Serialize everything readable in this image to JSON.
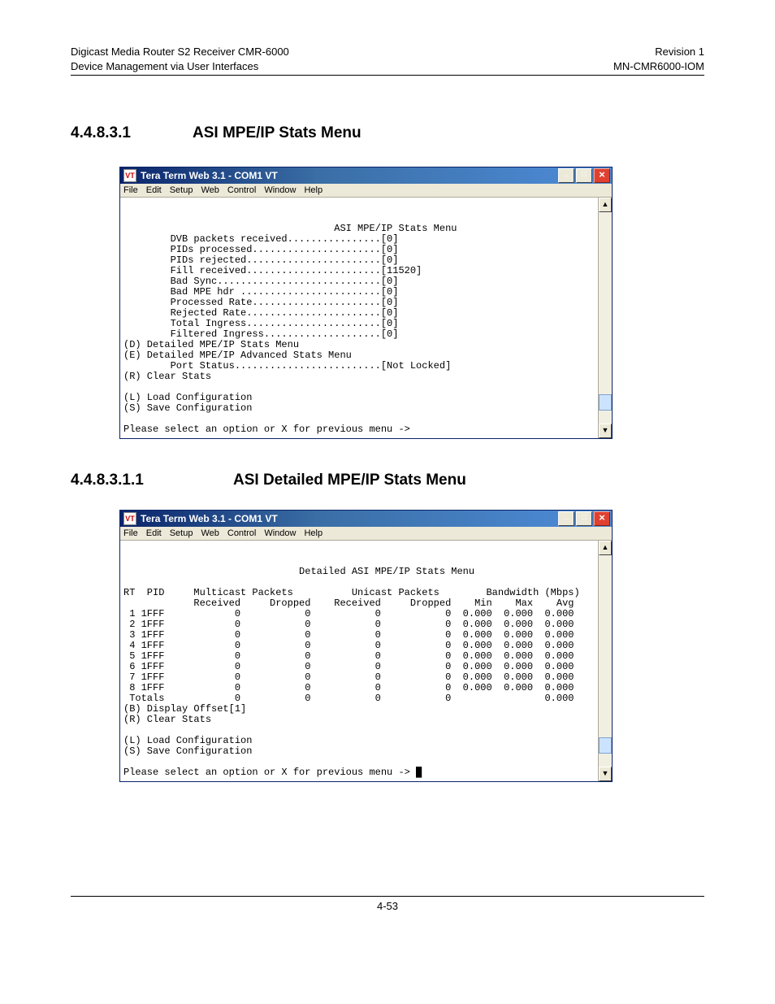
{
  "header": {
    "left_line1": "Digicast Media Router S2 Receiver CMR-6000",
    "left_line2": "Device Management via User Interfaces",
    "right_line1": "Revision 1",
    "right_line2": "MN-CMR6000-IOM"
  },
  "section1": {
    "num": "4.4.8.3.1",
    "title": "ASI MPE/IP Stats Menu"
  },
  "section2": {
    "num": "4.4.8.3.1.1",
    "title": "ASI Detailed MPE/IP Stats Menu"
  },
  "tt": {
    "app_title": "Tera Term Web 3.1 - COM1 VT",
    "menu": [
      "File",
      "Edit",
      "Setup",
      "Web",
      "Control",
      "Window",
      "Help"
    ]
  },
  "term1": "\n\n                                    ASI MPE/IP Stats Menu\n        DVB packets received................[0]\n        PIDs processed......................[0]\n        PIDs rejected.......................[0]\n        Fill received.......................[11520]\n        Bad Sync............................[0]\n        Bad MPE hdr ........................[0]\n        Processed Rate......................[0]\n        Rejected Rate.......................[0]\n        Total Ingress.......................[0]\n        Filtered Ingress....................[0]\n(D) Detailed MPE/IP Stats Menu\n(E) Detailed MPE/IP Advanced Stats Menu\n        Port Status.........................[Not Locked]\n(R) Clear Stats\n\n(L) Load Configuration\n(S) Save Configuration\n\nPlease select an option or X for previous menu ->",
  "term2": "\n\n                              Detailed ASI MPE/IP Stats Menu\n\nRT  PID     Multicast Packets          Unicast Packets        Bandwidth (Mbps)\n            Received     Dropped    Received     Dropped    Min    Max    Avg\n 1 1FFF            0           0           0           0  0.000  0.000  0.000\n 2 1FFF            0           0           0           0  0.000  0.000  0.000\n 3 1FFF            0           0           0           0  0.000  0.000  0.000\n 4 1FFF            0           0           0           0  0.000  0.000  0.000\n 5 1FFF            0           0           0           0  0.000  0.000  0.000\n 6 1FFF            0           0           0           0  0.000  0.000  0.000\n 7 1FFF            0           0           0           0  0.000  0.000  0.000\n 8 1FFF            0           0           0           0  0.000  0.000  0.000\n Totals            0           0           0           0                0.000\n(B) Display Offset[1]\n(R) Clear Stats\n\n(L) Load Configuration\n(S) Save Configuration\n\nPlease select an option or X for previous menu -> █",
  "footer": {
    "page": "4-53"
  }
}
